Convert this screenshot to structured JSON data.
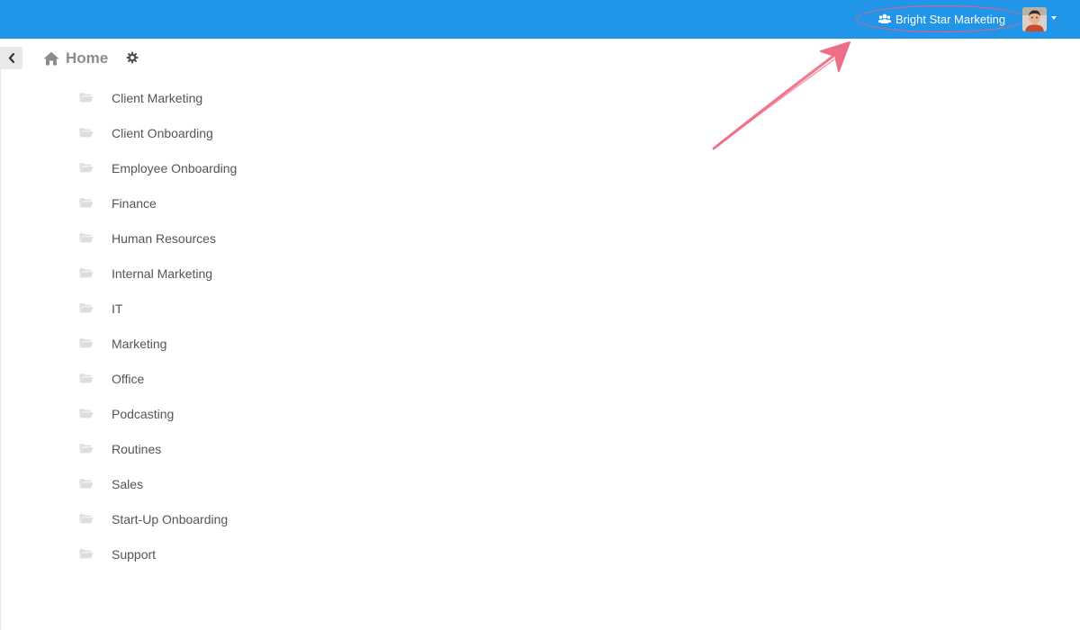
{
  "header": {
    "organization": "Bright Star Marketing",
    "organization_icon": "users-icon",
    "avatar": "user-avatar",
    "menu_icon": "caret-down-icon",
    "background_color": "#2196e8"
  },
  "sidebar": {
    "collapse_icon": "chevron-left-icon"
  },
  "breadcrumb": {
    "home_label": "Home",
    "home_icon": "home-icon",
    "settings_icon": "gear-icon"
  },
  "folders": [
    {
      "label": "Client Marketing"
    },
    {
      "label": "Client Onboarding"
    },
    {
      "label": "Employee Onboarding"
    },
    {
      "label": "Finance"
    },
    {
      "label": "Human Resources"
    },
    {
      "label": "Internal Marketing"
    },
    {
      "label": "IT"
    },
    {
      "label": "Marketing"
    },
    {
      "label": "Office"
    },
    {
      "label": "Podcasting"
    },
    {
      "label": "Routines"
    },
    {
      "label": "Sales"
    },
    {
      "label": "Start-Up Onboarding"
    },
    {
      "label": "Support"
    }
  ],
  "annotation": {
    "color": "#ec5f7b"
  }
}
